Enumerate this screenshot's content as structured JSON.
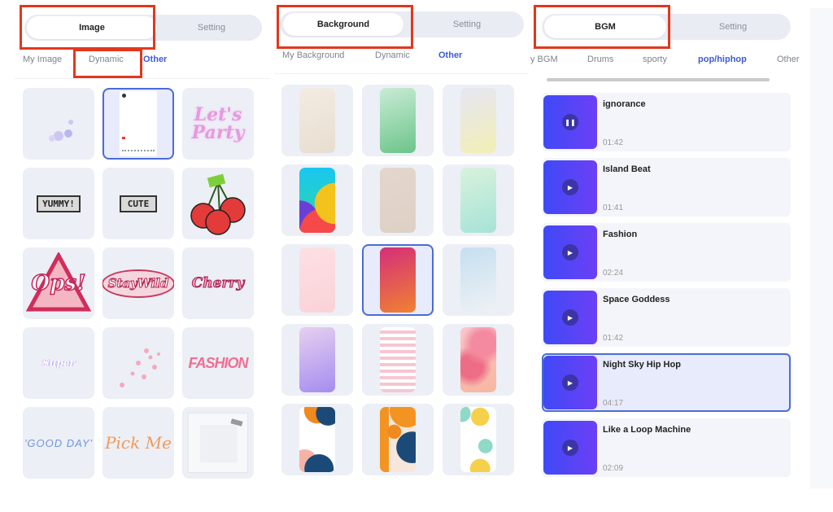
{
  "image_panel": {
    "segment": {
      "active": "Image",
      "inactive": "Setting"
    },
    "subtabs": [
      "My Image",
      "Dynamic",
      "Other"
    ],
    "selected_subtab": "Other",
    "highlighted_subtab": "Dynamic",
    "stickers": [
      {
        "name": "sparkle-bubbles"
      },
      {
        "name": "social-post-frame"
      },
      {
        "name": "lets-party-neon",
        "text": "Let's Party"
      },
      {
        "name": "yummy-pixel-badge",
        "text": "YUMMY!"
      },
      {
        "name": "cute-pixel-badge",
        "text": "CUTE"
      },
      {
        "name": "pixel-cherries"
      },
      {
        "name": "ops-triangle",
        "text": "Ops!"
      },
      {
        "name": "stay-wild-badge",
        "text": "StayWild"
      },
      {
        "name": "cherry-logo",
        "text": "Cherry"
      },
      {
        "name": "super-text",
        "text": "Super"
      },
      {
        "name": "pink-butterflies"
      },
      {
        "name": "fashion-text",
        "text": "FASHION"
      },
      {
        "name": "good-day-text",
        "text": "'GOOD DAY'"
      },
      {
        "name": "pick-me-text",
        "text": "Pick Me"
      },
      {
        "name": "film-frame"
      }
    ],
    "selected_index": 1
  },
  "background_panel": {
    "segment": {
      "active": "Background",
      "inactive": "Setting"
    },
    "subtabs": [
      "My Background",
      "Dynamic",
      "Other"
    ],
    "selected_subtab": "Other",
    "backgrounds": [
      {
        "name": "cream-waves",
        "colors": [
          "#f3ece2",
          "#e8ddd0"
        ]
      },
      {
        "name": "green-glass",
        "colors": [
          "#c9ecd5",
          "#6cc48a"
        ]
      },
      {
        "name": "lavender-yellow",
        "colors": [
          "#e6e6f5",
          "#f2efb4"
        ]
      },
      {
        "name": "rainbow-material",
        "colors": [
          "#18c6f0",
          "#f0b41e"
        ]
      },
      {
        "name": "beige-speckle",
        "colors": [
          "#e4d6cc",
          "#ddd0c5"
        ]
      },
      {
        "name": "mint-gradient",
        "colors": [
          "#d8f2dc",
          "#a6e3d7"
        ]
      },
      {
        "name": "pale-pink",
        "colors": [
          "#fde0e4",
          "#fad2d8"
        ]
      },
      {
        "name": "magenta-orange",
        "colors": [
          "#d42e7a",
          "#f08232"
        ]
      },
      {
        "name": "ice-blue-paper",
        "colors": [
          "#c6dff0",
          "#eef2f5"
        ]
      },
      {
        "name": "purple-dream",
        "colors": [
          "#e6d0ef",
          "#a58cf0"
        ]
      },
      {
        "name": "pink-gingham",
        "colors": [
          "#ffffff",
          "#f6c6d3"
        ]
      },
      {
        "name": "pink-hearts",
        "colors": [
          "#f7b4bd",
          "#ef7f95"
        ]
      },
      {
        "name": "abstract-navy-orange",
        "colors": [
          "#ffffff",
          "#1c4a78"
        ]
      },
      {
        "name": "abstract-orange-cream",
        "colors": [
          "#f6e6dc",
          "#f39422"
        ]
      },
      {
        "name": "memphis-pastel",
        "colors": [
          "#ffffff",
          "#f5d04a"
        ]
      }
    ],
    "selected_index": 7
  },
  "bgm_panel": {
    "segment": {
      "active": "BGM",
      "inactive": "Setting"
    },
    "subtabs": [
      "y BGM",
      "Drums",
      "sporty",
      "pop/hiphop",
      "Other"
    ],
    "selected_subtab": "pop/hiphop",
    "tracks": [
      {
        "title": "ignorance",
        "duration": "01:42",
        "state": "playing"
      },
      {
        "title": "Island Beat",
        "duration": "01:41",
        "state": "paused"
      },
      {
        "title": "Fashion",
        "duration": "02:24",
        "state": "paused"
      },
      {
        "title": "Space Goddess",
        "duration": "01:42",
        "state": "paused"
      },
      {
        "title": "Night Sky Hip Hop",
        "duration": "04:17",
        "state": "paused"
      },
      {
        "title": "Like a Loop Machine",
        "duration": "02:09",
        "state": "paused"
      }
    ],
    "selected_index": 4
  },
  "icons": {
    "play": "▶",
    "pause": "❚❚"
  },
  "colors": {
    "accent": "#3d5bd9",
    "highlight_box": "#e3371e",
    "cover_start": "#3f4af7",
    "cover_end": "#6c3ff5"
  }
}
